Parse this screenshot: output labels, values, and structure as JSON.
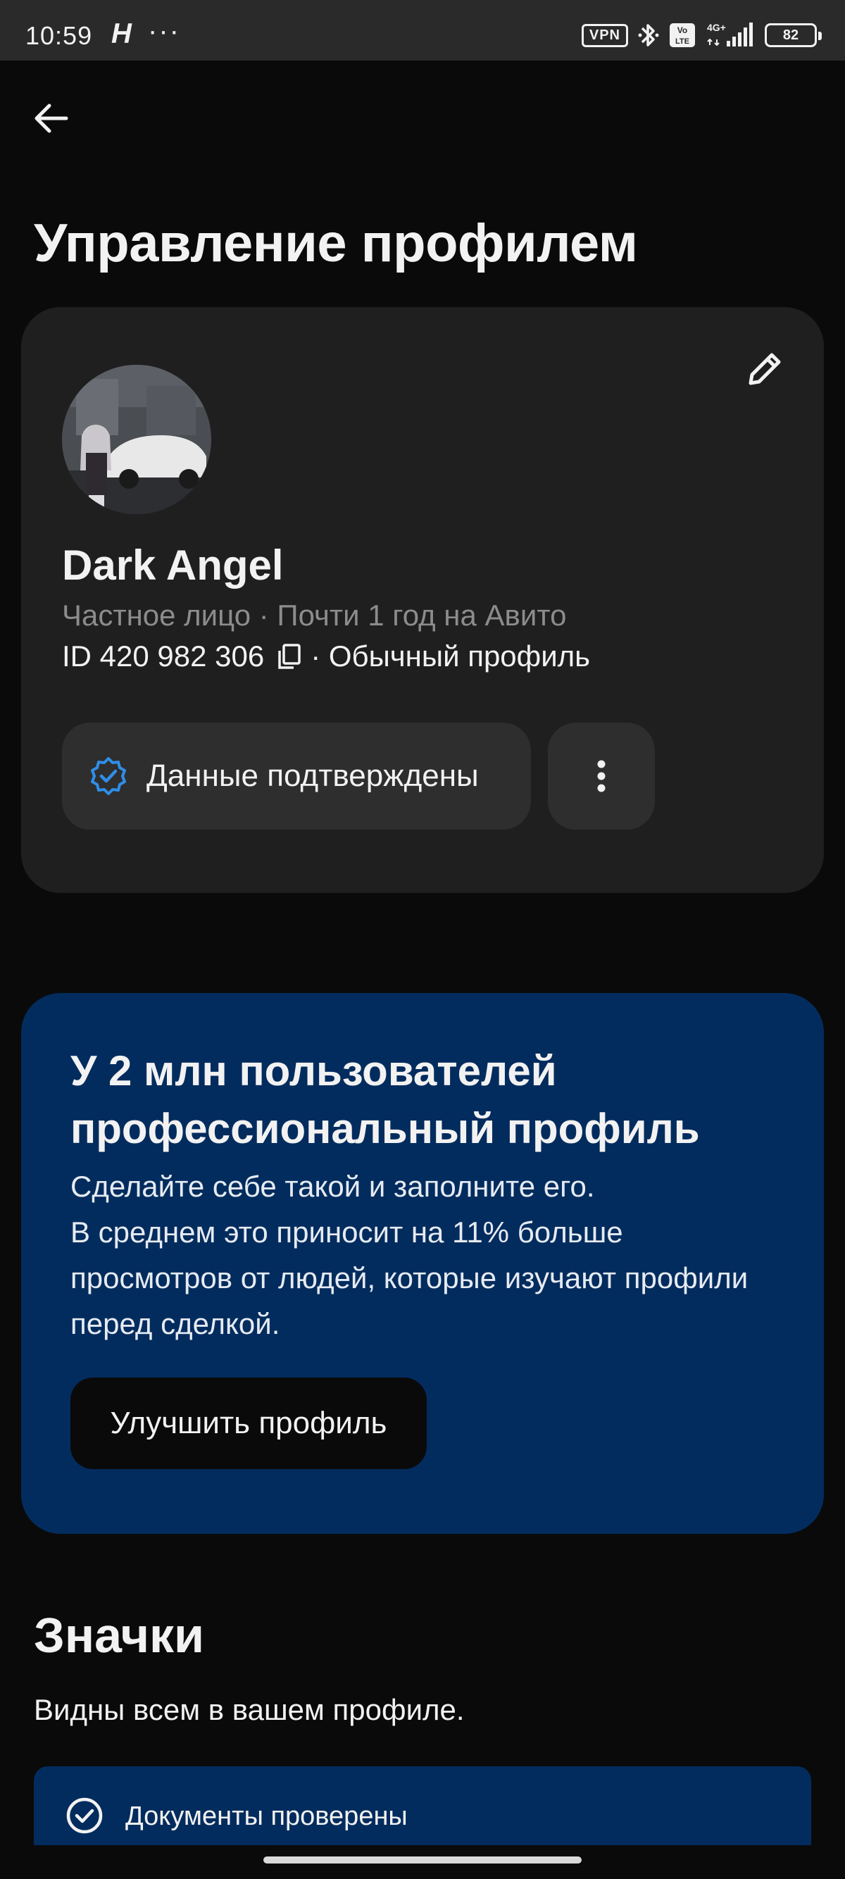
{
  "status_bar": {
    "time": "10:59",
    "app_indicator": "H",
    "more": "···",
    "vpn": "VPN",
    "volte": "Vo LTE",
    "network": "4G+",
    "battery": "82"
  },
  "header": {
    "back_icon": "arrow-left-icon",
    "title": "Управление профилем"
  },
  "profile": {
    "name": "Dark Angel",
    "meta": "Частное лицо · Почти 1 год на Авито",
    "id_text": "ID 420 982 306",
    "profile_type": "· Обычный профиль",
    "verified_label": "Данные подтверждены",
    "edit_icon": "pencil-icon",
    "more_icon": "more-vertical-icon"
  },
  "promo": {
    "title": "У 2 млн пользователей профессиональный профиль",
    "text_line1": "Сделайте себе такой и заполните его.",
    "text_line2": "В среднем это приносит на 11% больше просмотров от людей, которые изучают профили перед сделкой.",
    "button_label": "Улучшить профиль"
  },
  "badges": {
    "title": "Значки",
    "subtitle": "Видны всем в вашем профиле.",
    "items": [
      {
        "label": "Документы проверены",
        "icon": "check-circle-icon"
      }
    ]
  },
  "colors": {
    "background": "#0a0a0a",
    "card": "#1f1f1f",
    "promo": "#032c5e",
    "verified_accent": "#2f8ee8"
  }
}
